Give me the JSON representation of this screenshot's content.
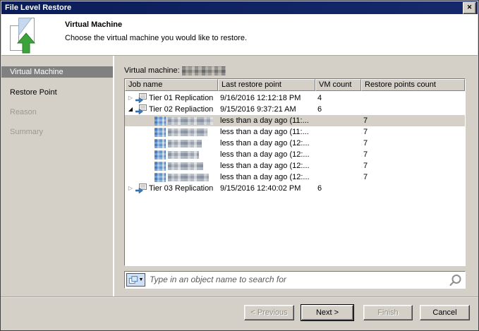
{
  "titlebar": {
    "title": "File Level Restore"
  },
  "icons": {
    "close": "✕",
    "expander_collapsed": "▷",
    "expander_expanded": "◢",
    "search_dropdown_arrow": "▼"
  },
  "colors": {
    "titlebar_blue": "#0d2060",
    "dialog_gray": "#d4d0c8",
    "sidebar_selected_gray": "#808080",
    "selected_row": "#d5d1c8",
    "restore_arrow_green": "#3ca23a",
    "job_icon_blue": "#3a7abf"
  },
  "header": {
    "title": "Virtual Machine",
    "subtitle": "Choose the virtual machine you would like to restore."
  },
  "sidebar": {
    "items": [
      {
        "label": "Virtual Machine",
        "state": "selected"
      },
      {
        "label": "Restore Point",
        "state": "enabled"
      },
      {
        "label": "Reason",
        "state": "disabled"
      },
      {
        "label": "Summary",
        "state": "disabled"
      }
    ]
  },
  "main": {
    "vm_label": "Virtual machine:",
    "vm_value_redacted": true,
    "table": {
      "columns": [
        "Job name",
        "Last restore point",
        "VM count",
        "Restore points count"
      ],
      "rows": [
        {
          "type": "job",
          "expander": "collapsed",
          "name": "Tier 01 Replication",
          "last_restore_point": "9/16/2016 12:12:18 PM",
          "vm_count": "4",
          "restore_points_count": "",
          "selected": false
        },
        {
          "type": "job",
          "expander": "expanded",
          "name": "Tier 02 Repliaction",
          "last_restore_point": "9/15/2016 9:37:21 AM",
          "vm_count": "6",
          "restore_points_count": "",
          "selected": false
        },
        {
          "type": "vm",
          "name_redacted": true,
          "last_restore_point": "less than a day ago (11:...",
          "vm_count": "",
          "restore_points_count": "7",
          "selected": true
        },
        {
          "type": "vm",
          "name_redacted": true,
          "last_restore_point": "less than a day ago (11:...",
          "vm_count": "",
          "restore_points_count": "7",
          "selected": false
        },
        {
          "type": "vm",
          "name_redacted": true,
          "last_restore_point": "less than a day ago (12:...",
          "vm_count": "",
          "restore_points_count": "7",
          "selected": false
        },
        {
          "type": "vm",
          "name_redacted": true,
          "last_restore_point": "less than a day ago (12:...",
          "vm_count": "",
          "restore_points_count": "7",
          "selected": false
        },
        {
          "type": "vm",
          "name_redacted": true,
          "last_restore_point": "less than a day ago (12:...",
          "vm_count": "",
          "restore_points_count": "7",
          "selected": false
        },
        {
          "type": "vm",
          "name_redacted": true,
          "last_restore_point": "less than a day ago (12:...",
          "vm_count": "",
          "restore_points_count": "7",
          "selected": false
        },
        {
          "type": "job",
          "expander": "collapsed",
          "name": "Tier 03 Replication",
          "last_restore_point": "9/15/2016 12:40:02 PM",
          "vm_count": "6",
          "restore_points_count": "",
          "selected": false
        }
      ]
    },
    "search": {
      "placeholder": "Type in an object name to search for"
    }
  },
  "footer": {
    "buttons": [
      {
        "label": "< Previous",
        "state": "disabled"
      },
      {
        "label": "Next >",
        "state": "default"
      },
      {
        "label": "Finish",
        "state": "disabled"
      },
      {
        "label": "Cancel",
        "state": "enabled"
      }
    ]
  }
}
